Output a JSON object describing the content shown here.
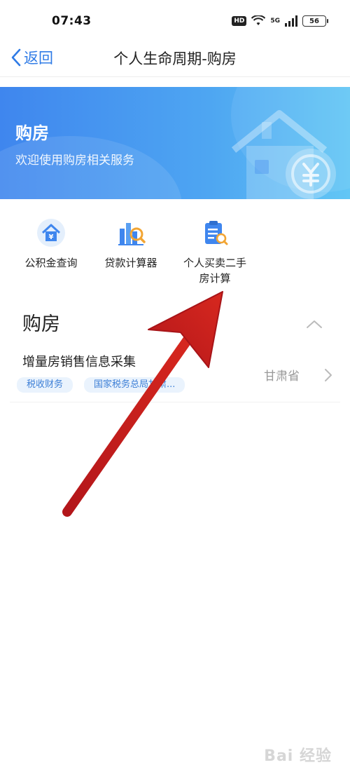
{
  "status_bar": {
    "time": "07:43",
    "hd_badge": "HD",
    "network_label": "5G",
    "battery": "56"
  },
  "nav": {
    "back_label": "返回",
    "title": "个人生命周期-购房"
  },
  "banner": {
    "title": "购房",
    "subtitle": "欢迎使用购房相关服务",
    "illustration_icon": "house-yuan-icon"
  },
  "quick_services": [
    {
      "label_line1": "公积金查询",
      "label_line2": "",
      "icon": "provident-fund-icon"
    },
    {
      "label_line1": "贷款计算器",
      "label_line2": "",
      "icon": "loan-calculator-icon"
    },
    {
      "label_line1": "个人买卖二手",
      "label_line2": "房计算",
      "icon": "clipboard-search-icon"
    }
  ],
  "section": {
    "title": "购房"
  },
  "services": [
    {
      "title": "增量房销售信息采集",
      "tags": [
        "税收财务",
        "国家税务总局甘肃..."
      ],
      "region": "甘肃省"
    }
  ],
  "colors": {
    "accent": "#2f7be6",
    "banner_start": "#3f86ee",
    "banner_end": "#62c6f5",
    "tag_text": "#3d7fd6",
    "tag_bg": "#eaf3fd",
    "annotation_arrow": "#c8201c"
  },
  "watermark": "Bai 经验"
}
